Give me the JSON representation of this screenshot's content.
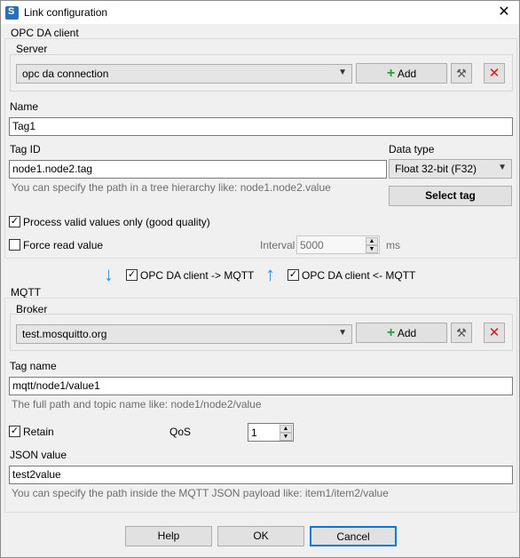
{
  "window": {
    "title": "Link configuration"
  },
  "opc": {
    "section_label": "OPC DA client",
    "server_label": "Server",
    "server_value": "opc da connection",
    "add_label": "Add",
    "name_label": "Name",
    "name_value": "Tag1",
    "tagid_label": "Tag ID",
    "tagid_value": "node1.node2.tag",
    "tagid_hint": "You can specify the path in a tree hierarchy like: node1.node2.value",
    "datatype_label": "Data type",
    "datatype_value": "Float 32-bit (F32)",
    "select_tag_label": "Select tag",
    "valid_only_label": "Process valid values only (good quality)",
    "force_read_label": "Force read value",
    "interval_label": "Interval",
    "interval_value": "5000",
    "interval_unit": "ms"
  },
  "direction": {
    "to_mqtt_label": "OPC DA client -> MQTT",
    "from_mqtt_label": "OPC DA client <- MQTT"
  },
  "mqtt": {
    "section_label": "MQTT",
    "broker_label": "Broker",
    "broker_value": "test.mosquitto.org",
    "add_label": "Add",
    "tagname_label": "Tag name",
    "tagname_value": "mqtt/node1/value1",
    "tagname_hint": "The full path and topic name like: node1/node2/value",
    "retain_label": "Retain",
    "qos_label": "QoS",
    "qos_value": "1",
    "json_label": "JSON value",
    "json_value": "test2value",
    "json_hint": "You can specify the path inside the MQTT JSON payload like: item1/item2/value"
  },
  "footer": {
    "help_label": "Help",
    "ok_label": "OK",
    "cancel_label": "Cancel"
  }
}
